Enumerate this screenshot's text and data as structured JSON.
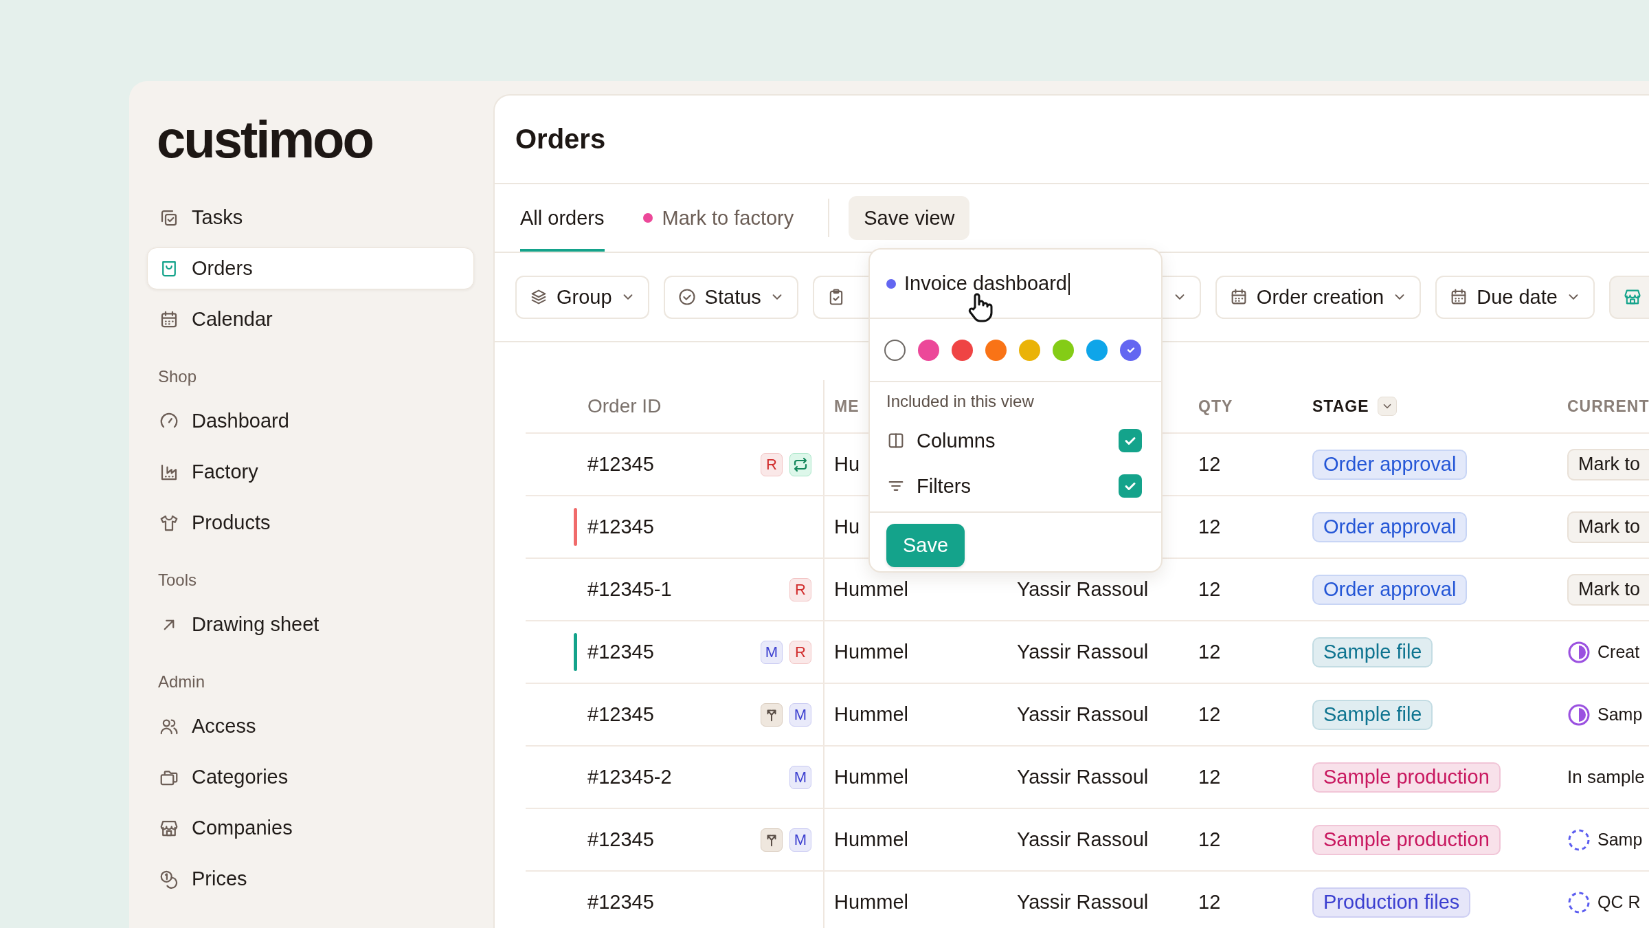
{
  "sidebar": {
    "logo": "custimoo",
    "sections": [
      {
        "items": [
          {
            "label": "Tasks",
            "selected": false
          },
          {
            "label": "Orders",
            "selected": true
          },
          {
            "label": "Calendar",
            "selected": false
          }
        ]
      },
      {
        "title": "Shop",
        "items": [
          {
            "label": "Dashboard",
            "selected": false
          },
          {
            "label": "Factory",
            "selected": false
          },
          {
            "label": "Products",
            "selected": false
          }
        ]
      },
      {
        "title": "Tools",
        "items": [
          {
            "label": "Drawing sheet",
            "selected": false
          }
        ]
      },
      {
        "title": "Admin",
        "items": [
          {
            "label": "Access",
            "selected": false
          },
          {
            "label": "Categories",
            "selected": false
          },
          {
            "label": "Companies",
            "selected": false
          },
          {
            "label": "Prices",
            "selected": false
          }
        ]
      }
    ]
  },
  "page": {
    "title": "Orders"
  },
  "tabs": [
    {
      "label": "All orders",
      "selected": true
    },
    {
      "label": "Mark to factory",
      "selected": false,
      "color": "#ec4899"
    }
  ],
  "save_view_button": "Save view",
  "filters": [
    {
      "kind": "dropdown",
      "label": "Group"
    },
    {
      "kind": "dropdown",
      "label": "Status"
    },
    {
      "kind": "covered"
    },
    {
      "kind": "dropdown",
      "label": "Order creation"
    },
    {
      "kind": "dropdown",
      "label": "Due date"
    },
    {
      "kind": "cut"
    }
  ],
  "table": {
    "columns": {
      "order_id": "Order ID",
      "merchant": "ME",
      "qty": "QTY",
      "stage": "STAGE",
      "current": "CURRENT"
    },
    "rows": [
      {
        "order_id": "#12345",
        "badges": [
          {
            "kind": "letter",
            "text": "R",
            "color": "#d12c2c"
          },
          {
            "kind": "repeat"
          }
        ],
        "merchant": "Hu",
        "qty": "12",
        "stage": {
          "label": "Order approval",
          "color": "#2456d6"
        },
        "current": {
          "kind": "chip",
          "text": "Mark to"
        }
      },
      {
        "order_id": "#12345",
        "color": "#f06b6b",
        "badges": [],
        "merchant": "Hu",
        "qty": "12",
        "stage": {
          "label": "Order approval",
          "color": "#2456d6"
        },
        "current": {
          "kind": "chip",
          "text": "Mark to"
        }
      },
      {
        "order_id": "#12345-1",
        "badges": [
          {
            "kind": "letter",
            "text": "R",
            "color": "#d12c2c"
          }
        ],
        "merchant": "Hummel",
        "person": "Yassir Rassoul",
        "qty": "12",
        "stage": {
          "label": "Order approval",
          "color": "#2456d6"
        },
        "current": {
          "kind": "chip",
          "text": "Mark to"
        }
      },
      {
        "order_id": "#12345",
        "color": "#14a38b",
        "badges": [
          {
            "kind": "letter",
            "text": "M",
            "color": "#3b3fd0"
          },
          {
            "kind": "letter",
            "text": "R",
            "color": "#d12c2c"
          }
        ],
        "merchant": "Hummel",
        "person": "Yassir Rassoul",
        "qty": "12",
        "stage": {
          "label": "Sample file",
          "color": "#0e7490"
        },
        "current": {
          "kind": "half",
          "text": "Creat"
        }
      },
      {
        "order_id": "#12345",
        "badges": [
          {
            "kind": "split"
          },
          {
            "kind": "letter",
            "text": "M",
            "color": "#3b3fd0"
          }
        ],
        "merchant": "Hummel",
        "person": "Yassir Rassoul",
        "qty": "12",
        "stage": {
          "label": "Sample file",
          "color": "#0e7490"
        },
        "current": {
          "kind": "half",
          "text": "Samp"
        }
      },
      {
        "order_id": "#12345-2",
        "badges": [
          {
            "kind": "letter",
            "text": "M",
            "color": "#3b3fd0"
          }
        ],
        "merchant": "Hummel",
        "person": "Yassir Rassoul",
        "qty": "12",
        "stage": {
          "label": "Sample production",
          "color": "#c8175f"
        },
        "current": {
          "kind": "plain",
          "text": "In sample"
        }
      },
      {
        "order_id": "#12345",
        "badges": [
          {
            "kind": "split"
          },
          {
            "kind": "letter",
            "text": "M",
            "color": "#3b3fd0"
          }
        ],
        "merchant": "Hummel",
        "person": "Yassir Rassoul",
        "qty": "12",
        "stage": {
          "label": "Sample production",
          "color": "#c8175f"
        },
        "current": {
          "kind": "dashed",
          "text": "Samp"
        }
      },
      {
        "order_id": "#12345",
        "badges": [],
        "merchant": "Hummel",
        "person": "Yassir Rassoul",
        "qty": "12",
        "stage": {
          "label": "Production files",
          "color": "#3b3fd0"
        },
        "current": {
          "kind": "dashed",
          "text": "QC R"
        }
      }
    ]
  },
  "save_view_popup": {
    "name": {
      "value": "Invoice dashboard",
      "color": "#6366f1"
    },
    "swatches": [
      {
        "kind": "none",
        "selected": false
      },
      {
        "kind": "color",
        "color": "#ec4899",
        "selected": false
      },
      {
        "kind": "color",
        "color": "#ef4444",
        "selected": false
      },
      {
        "kind": "color",
        "color": "#f97316",
        "selected": false
      },
      {
        "kind": "color",
        "color": "#eab308",
        "selected": false
      },
      {
        "kind": "color",
        "color": "#84cc16",
        "selected": false
      },
      {
        "kind": "color",
        "color": "#0ea5e9",
        "selected": false
      },
      {
        "kind": "color",
        "color": "#6366f1",
        "selected": true
      }
    ],
    "section_title": "Included in this view",
    "options": [
      {
        "label": "Columns",
        "checked": true
      },
      {
        "label": "Filters",
        "checked": true
      }
    ],
    "save_button": "Save"
  }
}
